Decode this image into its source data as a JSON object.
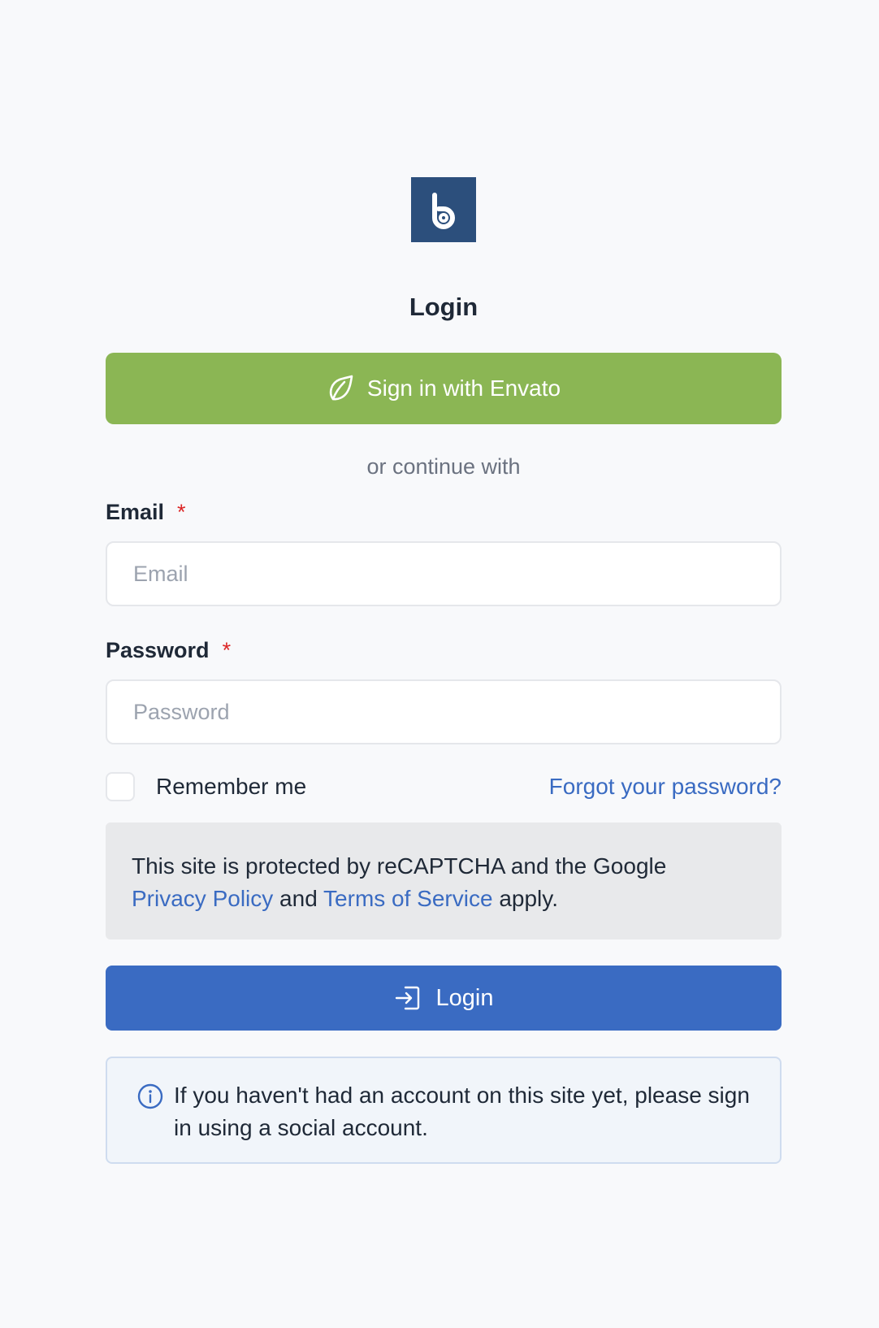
{
  "page": {
    "title": "Login"
  },
  "colors": {
    "background": "#f8f9fb",
    "envato_green": "#8bb654",
    "primary_blue": "#3a6bc2",
    "logo_navy": "#2c4f7c",
    "required_red": "#dc2626"
  },
  "logo": {
    "icon": "b-brand-logo"
  },
  "envato": {
    "icon": "envato-leaf-icon",
    "label": "Sign in with Envato"
  },
  "divider": {
    "text": "or continue with"
  },
  "form": {
    "email": {
      "label": "Email",
      "required_mark": "*",
      "placeholder": "Email",
      "value": ""
    },
    "password": {
      "label": "Password",
      "required_mark": "*",
      "placeholder": "Password",
      "value": ""
    },
    "remember": {
      "label": "Remember me",
      "checked": false
    },
    "forgot_link": "Forgot your password?"
  },
  "recaptcha": {
    "text_before": "This site is protected by reCAPTCHA and the Google",
    "privacy_link": "Privacy Policy",
    "and": "and",
    "terms_link": "Terms of Service",
    "text_after": "apply."
  },
  "login_button": {
    "icon": "login-icon",
    "label": "Login"
  },
  "info": {
    "icon": "info-icon",
    "text": "If you haven't had an account on this site yet, please sign in using a social account."
  }
}
